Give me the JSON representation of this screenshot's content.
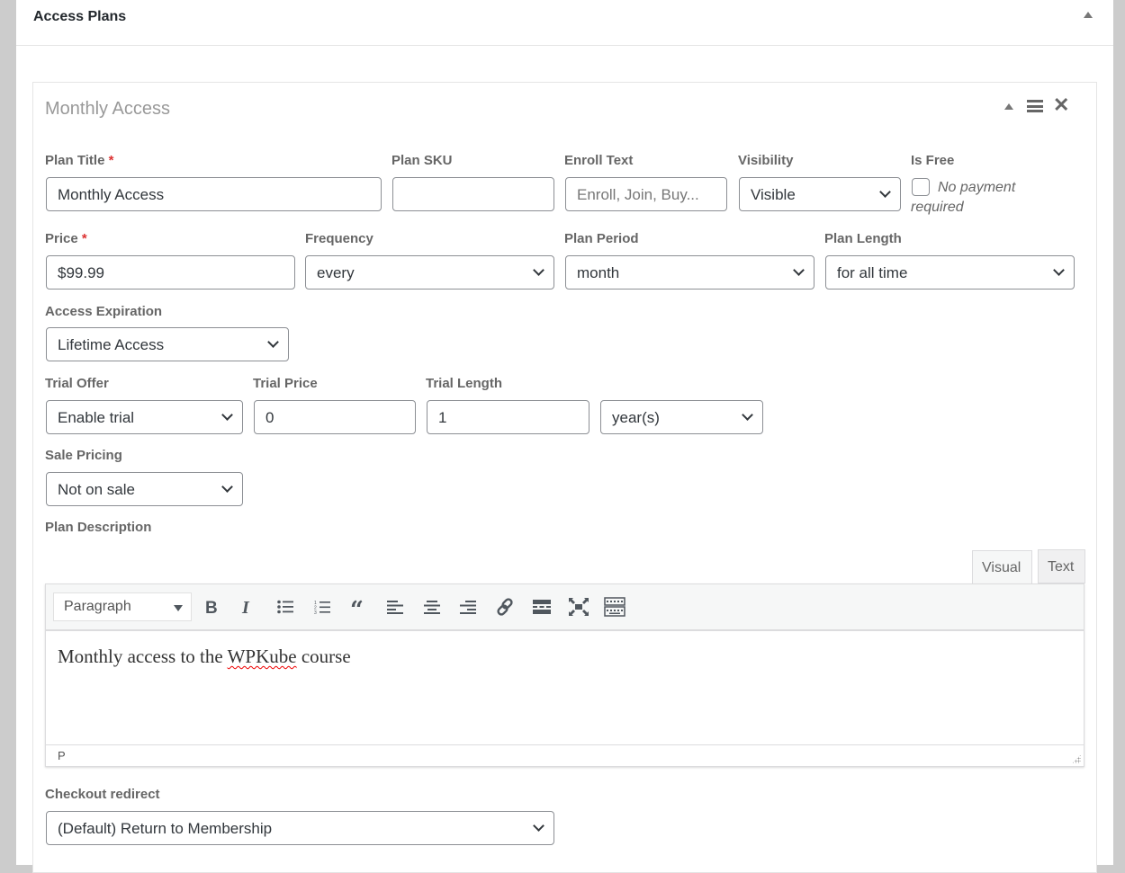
{
  "postbox": {
    "title": "Access Plans",
    "toggle_icon": "triangle-up-icon"
  },
  "plan": {
    "title": "Monthly Access",
    "icons": [
      "triangle-up-icon",
      "menu-icon",
      "close-icon"
    ],
    "close_glyph": "✕",
    "fields": {
      "plan_title": {
        "label": "Plan Title",
        "required": "*",
        "value": "Monthly Access"
      },
      "plan_sku": {
        "label": "Plan SKU",
        "value": ""
      },
      "enroll_text": {
        "label": "Enroll Text",
        "placeholder": "Enroll, Join, Buy..."
      },
      "visibility": {
        "label": "Visibility",
        "value": "Visible"
      },
      "is_free": {
        "label": "Is Free",
        "checked": false,
        "text_line1": "No payment",
        "text_line2": "required"
      },
      "price": {
        "label": "Price",
        "required": "*",
        "value": "$99.99"
      },
      "frequency": {
        "label": "Frequency",
        "value": "every"
      },
      "plan_period": {
        "label": "Plan Period",
        "value": "month"
      },
      "plan_length": {
        "label": "Plan Length",
        "value": "for all time"
      },
      "access_expiration": {
        "label": "Access Expiration",
        "value": "Lifetime Access"
      },
      "trial_offer": {
        "label": "Trial Offer",
        "value": "Enable trial"
      },
      "trial_price": {
        "label": "Trial Price",
        "value": "0"
      },
      "trial_length": {
        "label": "Trial Length",
        "value": "1",
        "unit": "year(s)"
      },
      "sale_pricing": {
        "label": "Sale Pricing",
        "value": "Not on sale"
      },
      "plan_description": {
        "label": "Plan Description"
      },
      "checkout_redirect": {
        "label": "Checkout redirect",
        "value": "(Default) Return to Membership"
      }
    },
    "editor": {
      "tabs": [
        {
          "label": "Visual",
          "active": true
        },
        {
          "label": "Text",
          "active": false
        }
      ],
      "format": "Paragraph",
      "toolbar": [
        "bold",
        "italic",
        "bulleted-list",
        "numbered-list",
        "blockquote",
        "align-left",
        "align-center",
        "align-right",
        "link",
        "read-more",
        "fullscreen",
        "toolbar-toggle"
      ],
      "content_before": "Monthly access to the ",
      "content_misspelled": "WPKube",
      "content_after": " course",
      "path": "P"
    }
  }
}
